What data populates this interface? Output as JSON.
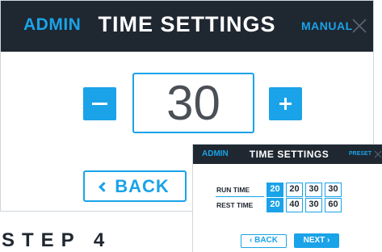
{
  "main": {
    "header": {
      "left_label": "ADMIN",
      "title": "TIME SETTINGS",
      "mode_label": "MANUAL",
      "close_icon": "close-icon"
    },
    "value": "30",
    "minus_icon": "minus-icon",
    "plus_icon": "plus-icon",
    "back_label": "BACK"
  },
  "step_label": "STEP 4",
  "preset": {
    "header": {
      "left_label": "ADMIN",
      "title": "TIME SETTINGS",
      "mode_label": "PRESET",
      "close_icon": "close-icon"
    },
    "rows": [
      {
        "label": "RUN TIME",
        "values": [
          "20",
          "20",
          "30",
          "30"
        ],
        "selected_index": 0
      },
      {
        "label": "REST TIME",
        "values": [
          "20",
          "40",
          "30",
          "60"
        ],
        "selected_index": 0
      }
    ],
    "back_label": "BACK",
    "next_label": "NEXT"
  },
  "colors": {
    "accent": "#1aa3e8",
    "header_bg": "#1f2731",
    "value_text": "#4b5057"
  }
}
